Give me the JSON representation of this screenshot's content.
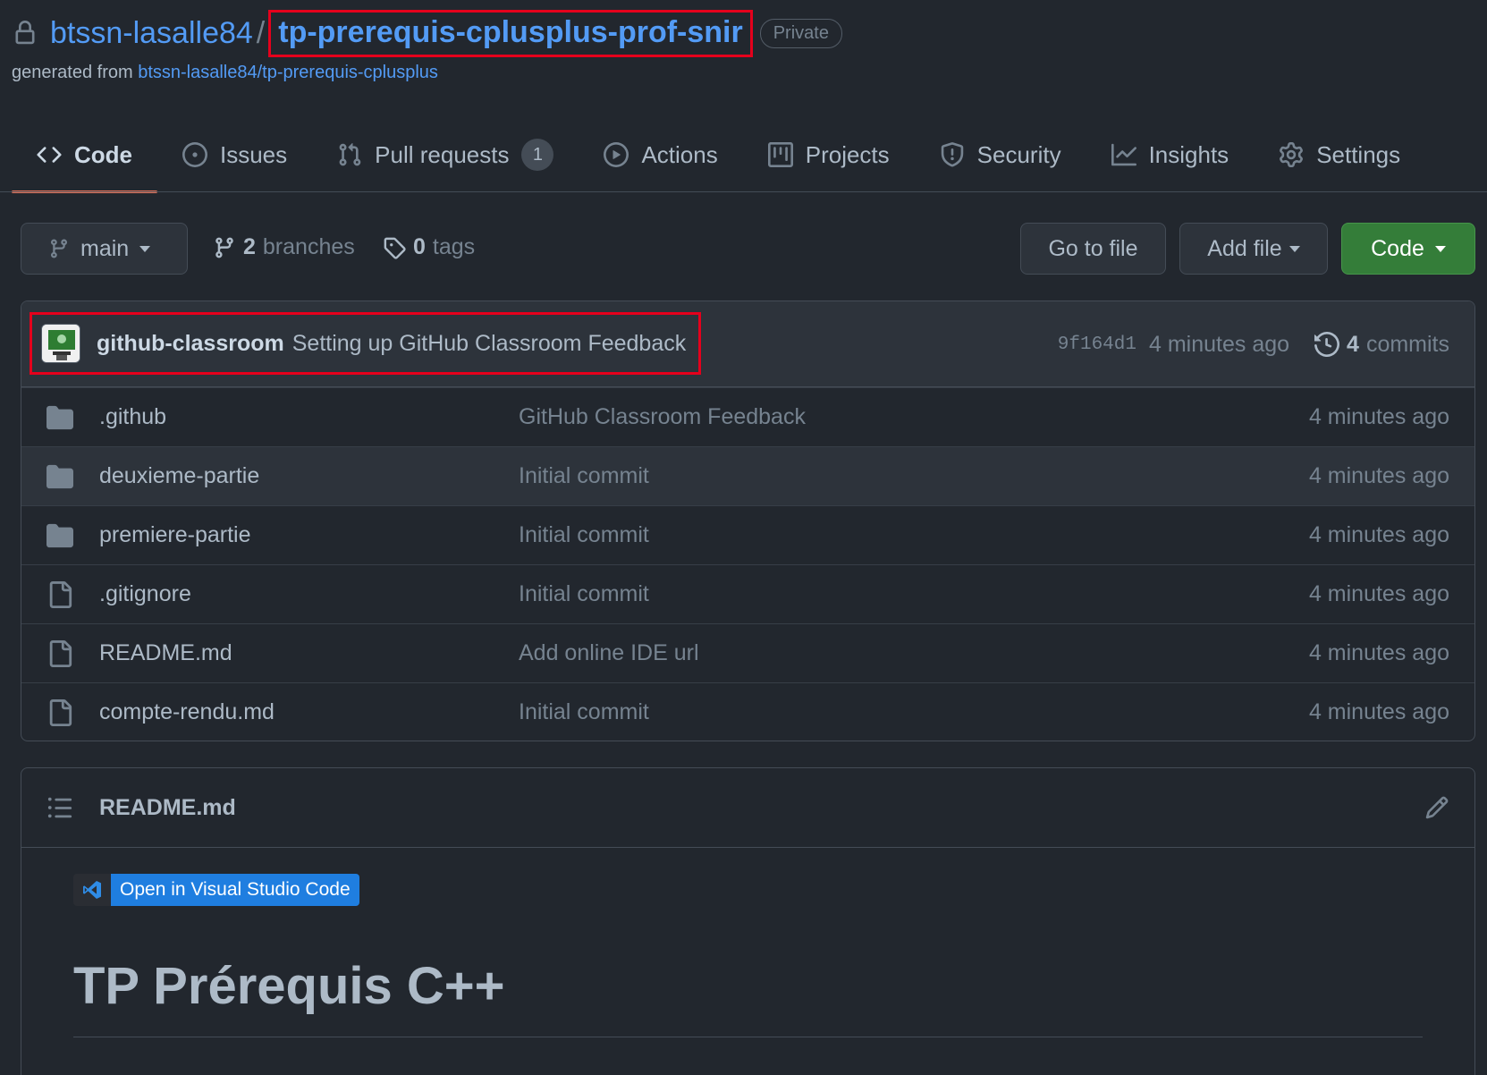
{
  "repo": {
    "owner": "btssn-lasalle84",
    "separator": "/",
    "name": "tp-prerequis-cplusplus-prof-snir",
    "visibility": "Private",
    "generated_prefix": "generated from",
    "template_link": "btssn-lasalle84/tp-prerequis-cplusplus"
  },
  "tabs": [
    {
      "label": "Code",
      "icon": "code-icon",
      "active": true
    },
    {
      "label": "Issues",
      "icon": "issue-icon"
    },
    {
      "label": "Pull requests",
      "icon": "pull-request-icon",
      "counter": "1"
    },
    {
      "label": "Actions",
      "icon": "play-icon"
    },
    {
      "label": "Projects",
      "icon": "project-icon"
    },
    {
      "label": "Security",
      "icon": "shield-icon"
    },
    {
      "label": "Insights",
      "icon": "graph-icon"
    },
    {
      "label": "Settings",
      "icon": "gear-icon"
    }
  ],
  "toolbar": {
    "branch": "main",
    "branches_count": "2",
    "branches_label": "branches",
    "tags_count": "0",
    "tags_label": "tags",
    "go_to_file": "Go to file",
    "add_file": "Add file",
    "code": "Code"
  },
  "latest_commit": {
    "author": "github-classroom",
    "message": "Setting up GitHub Classroom Feedback",
    "sha": "9f164d1",
    "age": "4 minutes ago",
    "commits_count": "4",
    "commits_label": "commits"
  },
  "files": [
    {
      "type": "folder",
      "name": ".github",
      "message": "GitHub Classroom Feedback",
      "age": "4 minutes ago"
    },
    {
      "type": "folder",
      "name": "deuxieme-partie",
      "message": "Initial commit",
      "age": "4 minutes ago"
    },
    {
      "type": "folder",
      "name": "premiere-partie",
      "message": "Initial commit",
      "age": "4 minutes ago"
    },
    {
      "type": "file",
      "name": ".gitignore",
      "message": "Initial commit",
      "age": "4 minutes ago"
    },
    {
      "type": "file",
      "name": "README.md",
      "message": "Add online IDE url",
      "age": "4 minutes ago"
    },
    {
      "type": "file",
      "name": "compte-rendu.md",
      "message": "Initial commit",
      "age": "4 minutes ago"
    }
  ],
  "readme": {
    "filename": "README.md",
    "badge_text": "Open in Visual Studio Code",
    "heading": "TP Prérequis C++"
  },
  "colors": {
    "background": "#22272e",
    "link": "#539bf5",
    "code_button": "#347d39",
    "active_tab_underline": "#ec775c",
    "highlight_box": "#e5001c",
    "vscode_badge": "#1f7ee0"
  }
}
